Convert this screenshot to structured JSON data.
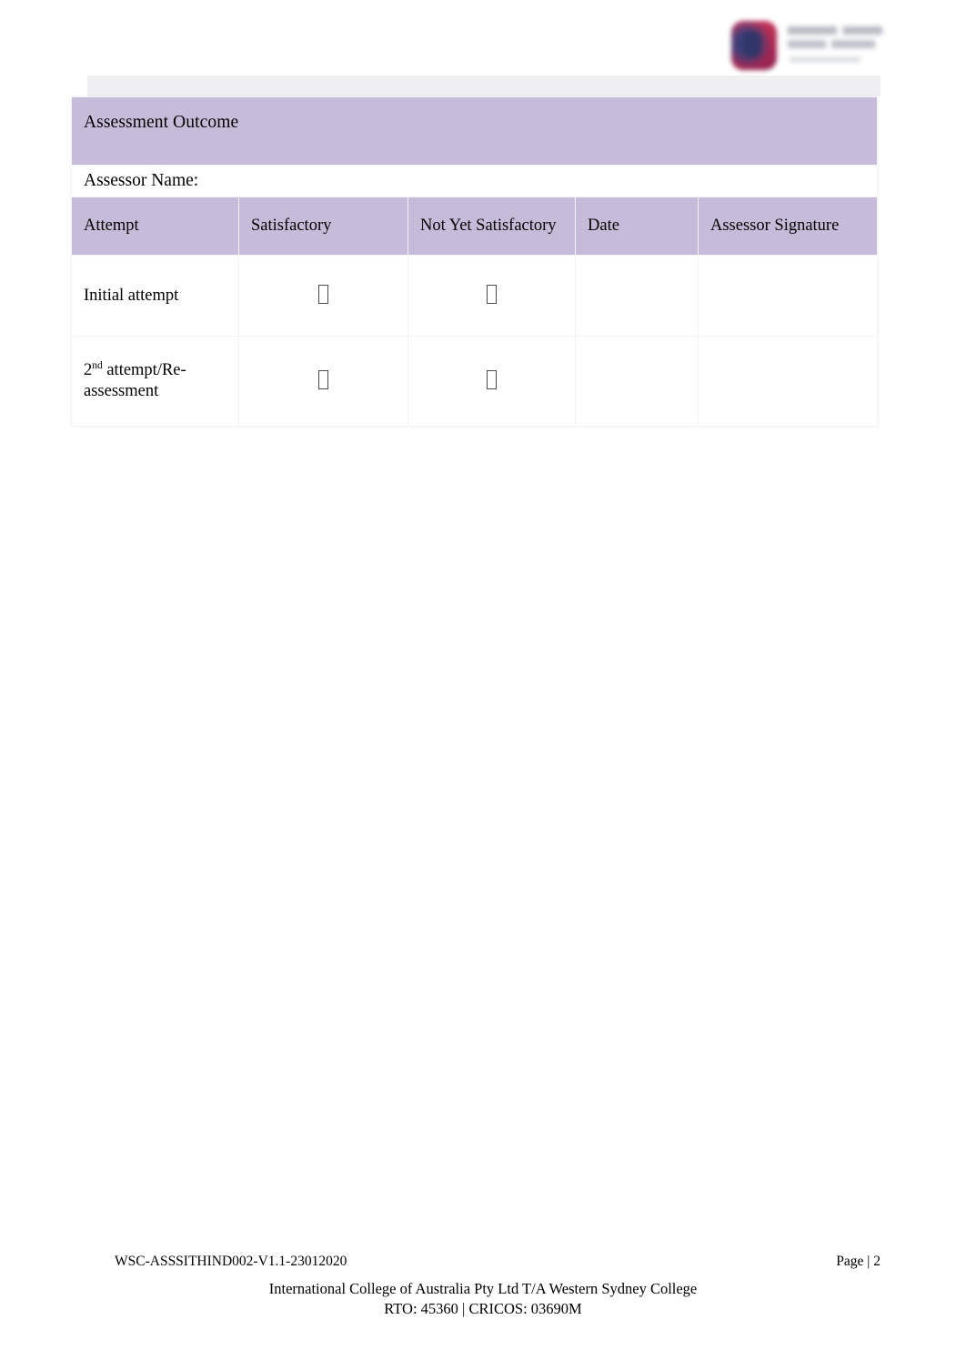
{
  "document": {
    "title": "Assessment Outcome",
    "page_label": "Page | 2"
  },
  "brand": {
    "logo_name": "western-sydney-college-logo",
    "mark_color": "#b52b52",
    "accent_color": "#3a3f7a"
  },
  "colors": {
    "header_band": "#c6bcd9",
    "column_header": "#c6bcd9",
    "top_band": "#f0f0f2",
    "cell_border": "#f4f4f6",
    "text": "#000000"
  },
  "table": {
    "section_heading": "Assessment Outcome",
    "assessor_name_label": "Assessor Name:",
    "assessor_name_value": "",
    "columns": [
      "Attempt",
      "Satisfactory",
      "Not Yet Satisfactory",
      "Date",
      "Assessor Signature"
    ],
    "rows": [
      {
        "attempt": "Initial attempt",
        "attempt_prefix": "",
        "attempt_sup": "",
        "satisfactory": "☐",
        "not_yet_satisfactory": "☐",
        "date": "",
        "assessor_signature": ""
      },
      {
        "attempt": "attempt/Re-assessment",
        "attempt_prefix": "2",
        "attempt_sup": "nd",
        "satisfactory": "☐",
        "not_yet_satisfactory": "☐",
        "date": "",
        "assessor_signature": ""
      }
    ]
  },
  "footer": {
    "document_code": "WSC-ASSSITHIND002-V1.1-23012020",
    "page_label": "Page | 2",
    "organisation": "International College of Australia Pty Ltd T/A Western Sydney College",
    "registration": "RTO: 45360 | CRICOS: 03690M"
  }
}
